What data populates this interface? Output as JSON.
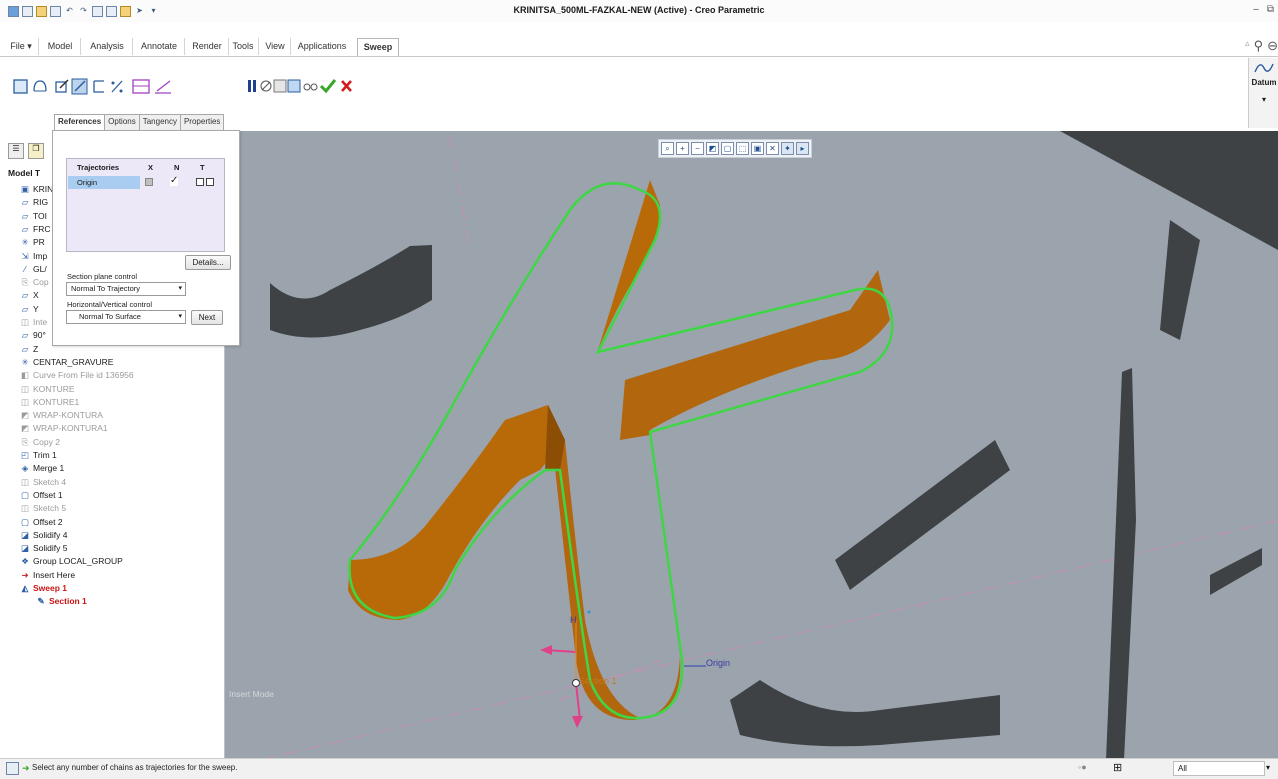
{
  "title": "KRINITSA_500ML-FAZKAL-NEW (Active) - Creo Parametric",
  "menu_tabs": [
    "File ▾",
    "Model",
    "Analysis",
    "Annotate",
    "Render",
    "Tools",
    "View",
    "Applications",
    "Sweep"
  ],
  "sweep_tools": {
    "pause_icon": "pause-icon",
    "ok_icon": "check-icon",
    "cancel_icon": "x-icon"
  },
  "sub_tabs": [
    "References",
    "Options",
    "Tangency",
    "Properties"
  ],
  "datum_label": "Datum",
  "references": {
    "columns": [
      "Trajectories",
      "X",
      "N",
      "T"
    ],
    "rows": [
      {
        "name": "Origin",
        "x": false,
        "n": true,
        "t": false
      }
    ],
    "details_label": "Details...",
    "section_plane_label": "Section plane control",
    "section_plane_value": "Normal To Trajectory",
    "hv_label": "Horizontal/Vertical control",
    "hv_value": "Normal To Surface",
    "next_label": "Next"
  },
  "tree": {
    "header": "Model T",
    "items": [
      {
        "label": "KRINIT",
        "icon": "part-icon",
        "style": "normal"
      },
      {
        "label": "RIG",
        "icon": "datum-plane-icon",
        "style": "normal"
      },
      {
        "label": "TOI",
        "icon": "datum-plane-icon",
        "style": "normal"
      },
      {
        "label": "FRC",
        "icon": "datum-plane-icon",
        "style": "normal"
      },
      {
        "label": "PR",
        "icon": "csys-icon",
        "style": "normal"
      },
      {
        "label": "Imp",
        "icon": "import-icon",
        "style": "normal"
      },
      {
        "label": "GL/",
        "icon": "curve-icon",
        "style": "normal"
      },
      {
        "label": "Cop",
        "icon": "copy-icon",
        "style": "dim"
      },
      {
        "label": "X",
        "icon": "datum-plane-icon",
        "style": "normal"
      },
      {
        "label": "Y",
        "icon": "datum-plane-icon",
        "style": "normal"
      },
      {
        "label": "Inte",
        "icon": "sketch-icon",
        "style": "dim"
      },
      {
        "label": "90°",
        "icon": "datum-plane-icon",
        "style": "normal"
      },
      {
        "label": "Z",
        "icon": "datum-plane-icon",
        "style": "normal"
      },
      {
        "label": "CENTAR_GRAVURE",
        "icon": "csys-icon",
        "style": "normal"
      },
      {
        "label": "Curve From File id 136956",
        "icon": "curve-file-icon",
        "style": "dim"
      },
      {
        "label": "KONTURE",
        "icon": "sketch-icon",
        "style": "dim"
      },
      {
        "label": "KONTURE1",
        "icon": "sketch-icon",
        "style": "dim"
      },
      {
        "label": "WRAP-KONTURA",
        "icon": "wrap-icon",
        "style": "dim"
      },
      {
        "label": "WRAP-KONTURA1",
        "icon": "wrap-icon",
        "style": "dim"
      },
      {
        "label": "Copy 2",
        "icon": "copy-icon",
        "style": "dim"
      },
      {
        "label": "Trim 1",
        "icon": "trim-icon",
        "style": "normal"
      },
      {
        "label": "Merge 1",
        "icon": "merge-icon",
        "style": "normal"
      },
      {
        "label": "Sketch 4",
        "icon": "sketch-icon",
        "style": "dim"
      },
      {
        "label": "Offset 1",
        "icon": "offset-icon",
        "style": "normal"
      },
      {
        "label": "Sketch 5",
        "icon": "sketch-icon",
        "style": "dim"
      },
      {
        "label": "Offset 2",
        "icon": "offset-icon",
        "style": "normal"
      },
      {
        "label": "Solidify 4",
        "icon": "solidify-icon",
        "style": "normal"
      },
      {
        "label": "Solidify 5",
        "icon": "solidify-icon",
        "style": "normal"
      },
      {
        "label": "Group LOCAL_GROUP",
        "icon": "group-icon",
        "style": "normal"
      },
      {
        "label": "Insert Here",
        "icon": "insert-arrow-icon",
        "style": "normal"
      },
      {
        "label": "Sweep 1",
        "icon": "sweep-icon",
        "style": "red"
      },
      {
        "label": "Section 1",
        "icon": "section-icon",
        "style": "red"
      }
    ]
  },
  "viewport": {
    "insert_mode": "Insert Mode",
    "label_origin": "Origin",
    "label_section": "Section 1",
    "label_h": "H",
    "colors": {
      "background": "#9ba4ad",
      "sweep": "#b86a08",
      "trajectory": "#3fd646",
      "extrusion": "#3f4245"
    }
  },
  "status": {
    "message": "Select any number of chains as trajectories for the sweep.",
    "filter": "All"
  }
}
